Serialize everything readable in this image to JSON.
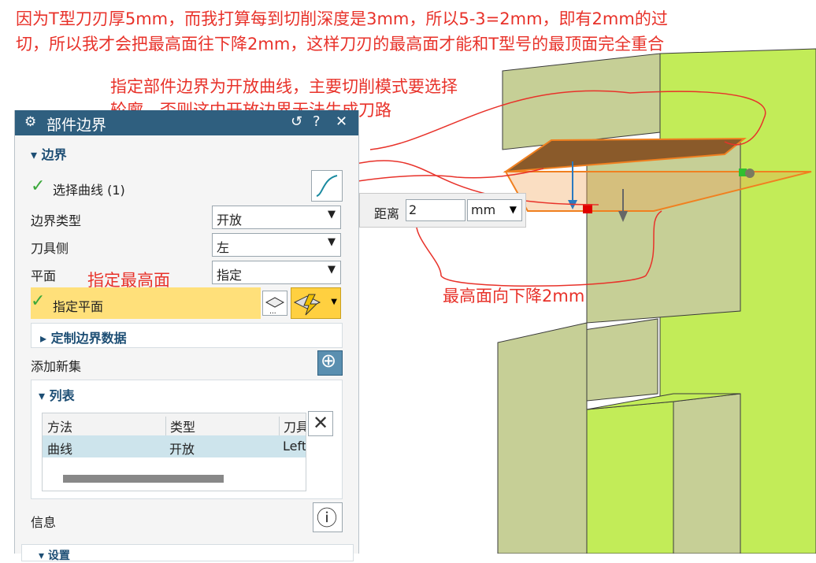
{
  "annotations": {
    "top_line1": "因为T型刀刃厚5mm，而我打算每到切削深度是3mm，所以5-3=2mm，即有2mm的过",
    "top_line2": "切，所以我才会把最高面往下降2mm，这样刀刃的最高面才能和T型号的最顶面完全重合",
    "boundary_line1": "指定部件边界为开放曲线，主要切削模式要选择",
    "boundary_line2": "轮廓，否则这中开放边界无法生成刀路",
    "plane_note": "指定最高面",
    "lower_note": "最高面向下降2mm"
  },
  "dialog": {
    "title": "部件边界",
    "boundary_section": "边界",
    "select_curve": "选择曲线 (1)",
    "boundary_type_label": "边界类型",
    "boundary_type_value": "开放",
    "tool_side_label": "刀具侧",
    "tool_side_value": "左",
    "plane_label": "平面",
    "plane_value": "指定",
    "specify_plane": "指定平面",
    "custom_data": "定制边界数据",
    "add_new_set": "添加新集",
    "list_section": "列表",
    "list_headers": [
      "方法",
      "类型",
      "刀具"
    ],
    "list_rows": [
      [
        "曲线",
        "开放",
        "Left"
      ]
    ],
    "info": "信息",
    "bottom_section": "设置"
  },
  "distance": {
    "label": "距离",
    "value": "2",
    "unit": "mm"
  },
  "colors": {
    "annotation": "#e8322a",
    "title_bar": "#2f5f7f",
    "highlight_row": "#ffe07a",
    "list_selected": "#cde4ec",
    "part_face_light": "#c2ec58",
    "part_face_shade": "#c6cf96",
    "plane": "#f0a050"
  }
}
